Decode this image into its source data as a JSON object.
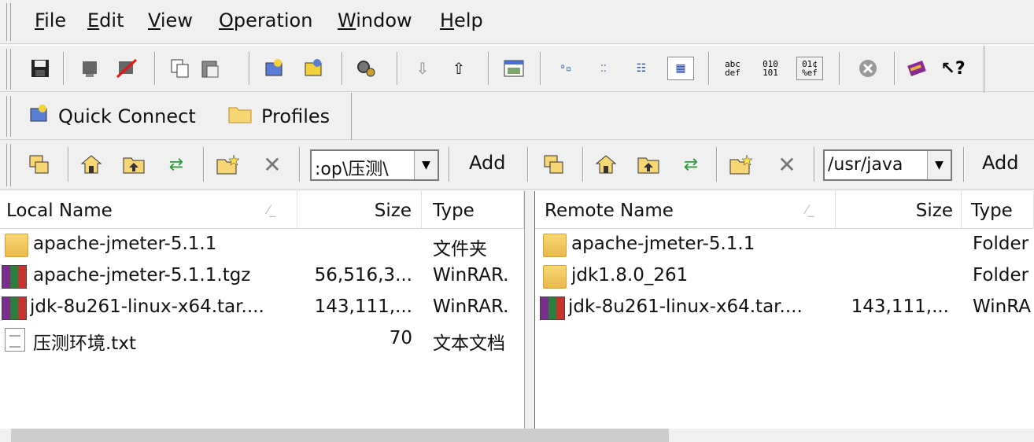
{
  "menu": {
    "file": "File",
    "edit": "Edit",
    "view": "View",
    "operation": "Operation",
    "window": "Window",
    "help": "Help"
  },
  "toolbar1": {
    "icons": [
      "save-icon",
      "disconnect-icon",
      "disconnect-red-icon",
      "copy-icon",
      "paste-icon",
      "transfer-upload-icon",
      "transfer-download-icon",
      "settings-gear-icon",
      "arrow-down-icon",
      "arrow-up-icon",
      "window-icon",
      "large-icons-view-icon",
      "small-icons-view-icon",
      "list-view-icon",
      "details-view-icon",
      "ascii-mode-icon",
      "binary-mode-icon",
      "auto-mode-icon",
      "stop-icon",
      "about-book-icon",
      "context-help-icon"
    ]
  },
  "toolbar2": {
    "quick_connect": "Quick Connect",
    "profiles": "Profiles"
  },
  "address": {
    "local_path": ":op\\压测\\",
    "remote_path": "/usr/java",
    "add_label": "Add"
  },
  "local": {
    "columns": {
      "name": "Local Name",
      "size": "Size",
      "type": "Type"
    },
    "rows": [
      {
        "icon": "folder-icon",
        "name": "apache-jmeter-5.1.1",
        "size": "",
        "type": "文件夹"
      },
      {
        "icon": "rar-archive-icon",
        "name": "apache-jmeter-5.1.1.tgz",
        "size": "56,516,3...",
        "type": "WinRAR."
      },
      {
        "icon": "rar-archive-icon",
        "name": "jdk-8u261-linux-x64.tar....",
        "size": "143,111,...",
        "type": "WinRAR."
      },
      {
        "icon": "text-file-icon",
        "name": "压测环境.txt",
        "size": "70",
        "type": "文本文档"
      }
    ]
  },
  "remote": {
    "columns": {
      "name": "Remote Name",
      "size": "Size",
      "type": "Type"
    },
    "rows": [
      {
        "icon": "folder-icon",
        "name": "apache-jmeter-5.1.1",
        "size": "",
        "type": "Folder"
      },
      {
        "icon": "folder-icon",
        "name": "jdk1.8.0_261",
        "size": "",
        "type": "Folder"
      },
      {
        "icon": "rar-archive-icon",
        "name": "jdk-8u261-linux-x64.tar....",
        "size": "143,111,...",
        "type": "WinRA"
      }
    ]
  }
}
